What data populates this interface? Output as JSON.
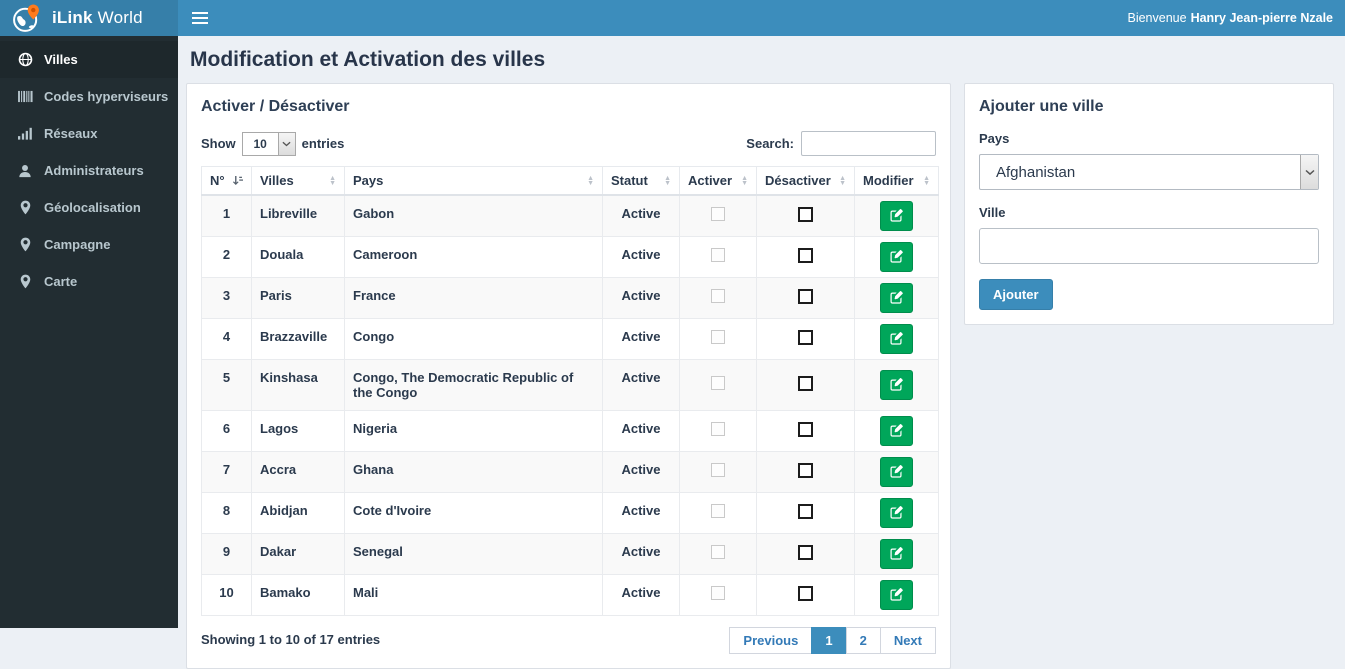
{
  "topbar": {
    "brand_bold": "iLink",
    "brand_rest": "World",
    "welcome_prefix": "Bienvenue",
    "welcome_name": "Hanry Jean-pierre Nzale"
  },
  "sidebar": {
    "items": [
      {
        "label": "Villes",
        "icon": "globe-icon",
        "active": true
      },
      {
        "label": "Codes hyperviseurs",
        "icon": "barcode-icon",
        "active": false
      },
      {
        "label": "Réseaux",
        "icon": "signal-bars-icon",
        "active": false
      },
      {
        "label": "Administrateurs",
        "icon": "user-icon",
        "active": false
      },
      {
        "label": "Géolocalisation",
        "icon": "map-marker-icon",
        "active": false
      },
      {
        "label": "Campagne",
        "icon": "map-marker-icon",
        "active": false
      },
      {
        "label": "Carte",
        "icon": "map-marker-icon",
        "active": false
      }
    ]
  },
  "page": {
    "title": "Modification et Activation des villes"
  },
  "table_panel": {
    "title": "Activer / Désactiver",
    "show_label": "Show",
    "page_length": "10",
    "entries_label": "entries",
    "search_label": "Search:",
    "search_value": "",
    "columns": [
      "N°",
      "Villes",
      "Pays",
      "Statut",
      "Activer",
      "Désactiver",
      "Modifier"
    ],
    "rows": [
      {
        "num": "1",
        "ville": "Libreville",
        "pays": "Gabon",
        "statut": "Active",
        "activer_checked": false,
        "desactiver_checked": false
      },
      {
        "num": "2",
        "ville": "Douala",
        "pays": "Cameroon",
        "statut": "Active",
        "activer_checked": false,
        "desactiver_checked": false
      },
      {
        "num": "3",
        "ville": "Paris",
        "pays": "France",
        "statut": "Active",
        "activer_checked": false,
        "desactiver_checked": false
      },
      {
        "num": "4",
        "ville": "Brazzaville",
        "pays": "Congo",
        "statut": "Active",
        "activer_checked": false,
        "desactiver_checked": false
      },
      {
        "num": "5",
        "ville": "Kinshasa",
        "pays": "Congo, The Democratic Republic of the Congo",
        "statut": "Active",
        "activer_checked": false,
        "desactiver_checked": false
      },
      {
        "num": "6",
        "ville": "Lagos",
        "pays": "Nigeria",
        "statut": "Active",
        "activer_checked": false,
        "desactiver_checked": false
      },
      {
        "num": "7",
        "ville": "Accra",
        "pays": "Ghana",
        "statut": "Active",
        "activer_checked": false,
        "desactiver_checked": false
      },
      {
        "num": "8",
        "ville": "Abidjan",
        "pays": "Cote d'Ivoire",
        "statut": "Active",
        "activer_checked": false,
        "desactiver_checked": false
      },
      {
        "num": "9",
        "ville": "Dakar",
        "pays": "Senegal",
        "statut": "Active",
        "activer_checked": false,
        "desactiver_checked": false
      },
      {
        "num": "10",
        "ville": "Bamako",
        "pays": "Mali",
        "statut": "Active",
        "activer_checked": false,
        "desactiver_checked": false
      }
    ],
    "footer": {
      "info": "Showing 1 to 10 of 17 entries",
      "pagination": [
        "Previous",
        "1",
        "2",
        "Next"
      ],
      "active_page": "1"
    }
  },
  "add_panel": {
    "title": "Ajouter une ville",
    "pays_label": "Pays",
    "pays_value": "Afghanistan",
    "ville_label": "Ville",
    "ville_value": "",
    "submit_label": "Ajouter"
  },
  "colors": {
    "accent": "#3c8dbc",
    "accent-dark": "#367fa9",
    "sidebar-bg": "#222d32",
    "sidebar-active-bg": "#1e282c",
    "success-green": "#00a65a",
    "page-bg": "#ecf0f5",
    "pin-orange": "#ff7b1c"
  }
}
